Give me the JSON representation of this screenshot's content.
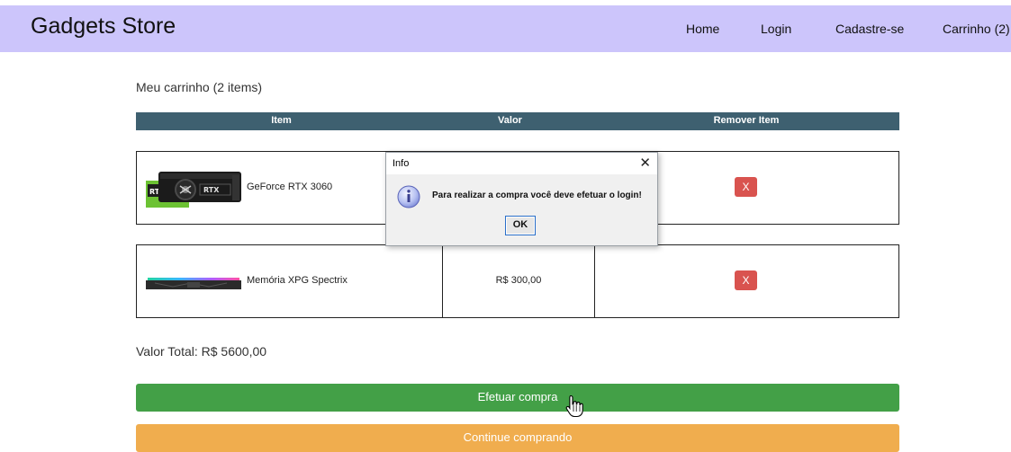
{
  "header": {
    "brand": "Gadgets Store",
    "nav": [
      "Home",
      "Login",
      "Cadastre-se",
      "Carrinho (2)"
    ]
  },
  "cart": {
    "heading": "Meu carrinho (2 items)",
    "columns": [
      "Item",
      "Valor",
      "Remover Item"
    ],
    "items": [
      {
        "name": "GeForce RTX 3060",
        "price": "",
        "image_icon": "graphics-card-icon",
        "remove_label": "X"
      },
      {
        "name": "Memória XPG Spectrix",
        "price": "R$ 300,00",
        "image_icon": "ram-module-icon",
        "remove_label": "X"
      }
    ],
    "total": "Valor Total: R$ 5600,00",
    "buy_label": "Efetuar compra",
    "continue_label": "Continue comprando"
  },
  "dialog": {
    "title": "Info",
    "close_glyph": "✕",
    "message": "Para realizar a compra você deve efetuar o login!",
    "ok_label": "OK",
    "icon": "info-icon"
  },
  "colors": {
    "navbar": "#ccc5fb",
    "table_header": "#3e6070",
    "remove": "#d9534f",
    "buy": "#43a047",
    "continue": "#f0ad4e"
  },
  "cursor": "hand-pointer-icon"
}
